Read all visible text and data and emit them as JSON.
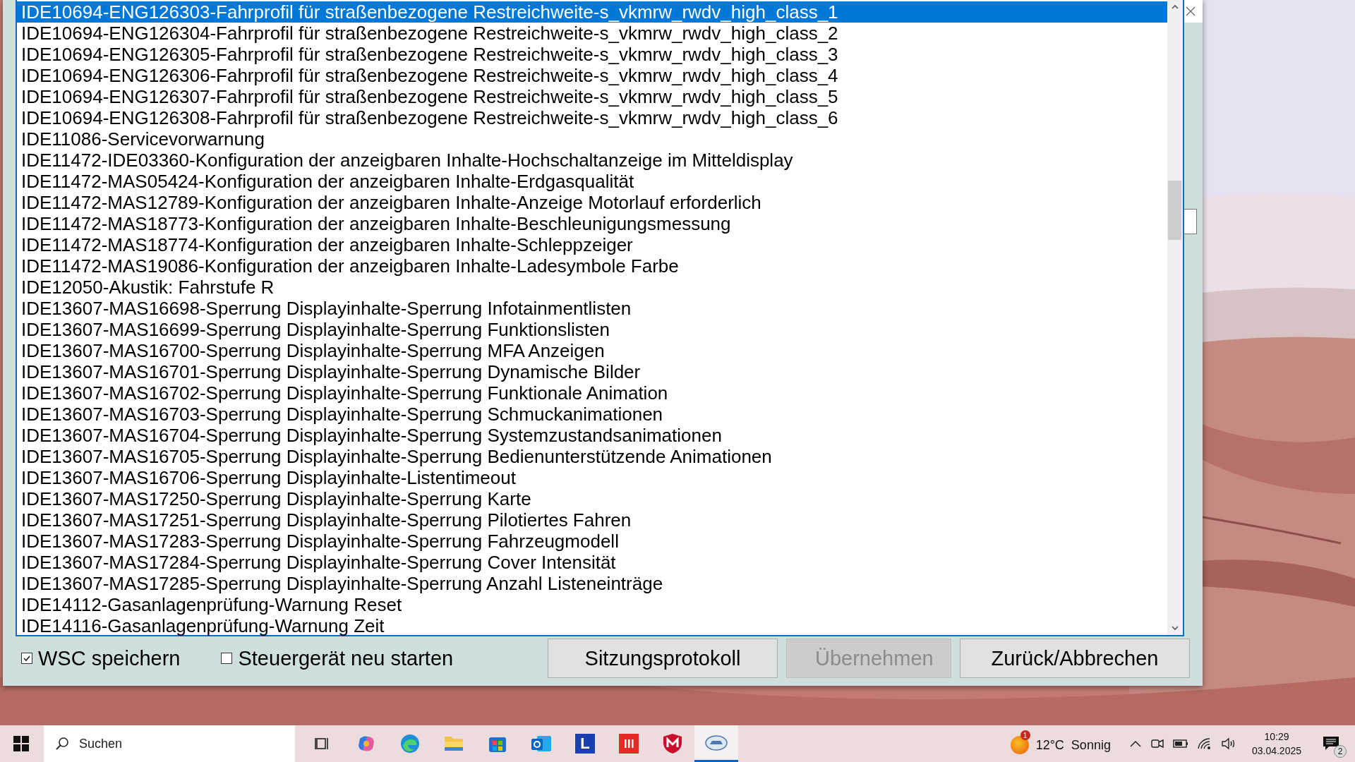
{
  "list": {
    "items": [
      {
        "text": "IDE10694-ENG126303-Fahrprofil für straßenbezogene Restreichweite-s_vkmrw_rwdv_high_class_1",
        "selected": true
      },
      {
        "text": "IDE10694-ENG126304-Fahrprofil für straßenbezogene Restreichweite-s_vkmrw_rwdv_high_class_2",
        "selected": false
      },
      {
        "text": "IDE10694-ENG126305-Fahrprofil für straßenbezogene Restreichweite-s_vkmrw_rwdv_high_class_3",
        "selected": false
      },
      {
        "text": "IDE10694-ENG126306-Fahrprofil für straßenbezogene Restreichweite-s_vkmrw_rwdv_high_class_4",
        "selected": false
      },
      {
        "text": "IDE10694-ENG126307-Fahrprofil für straßenbezogene Restreichweite-s_vkmrw_rwdv_high_class_5",
        "selected": false
      },
      {
        "text": "IDE10694-ENG126308-Fahrprofil für straßenbezogene Restreichweite-s_vkmrw_rwdv_high_class_6",
        "selected": false
      },
      {
        "text": "IDE11086-Servicevorwarnung",
        "selected": false
      },
      {
        "text": "IDE11472-IDE03360-Konfiguration der anzeigbaren Inhalte-Hochschaltanzeige im Mitteldisplay",
        "selected": false
      },
      {
        "text": "IDE11472-MAS05424-Konfiguration der anzeigbaren Inhalte-Erdgasqualität",
        "selected": false
      },
      {
        "text": "IDE11472-MAS12789-Konfiguration der anzeigbaren Inhalte-Anzeige Motorlauf erforderlich",
        "selected": false
      },
      {
        "text": "IDE11472-MAS18773-Konfiguration der anzeigbaren Inhalte-Beschleunigungsmessung",
        "selected": false
      },
      {
        "text": "IDE11472-MAS18774-Konfiguration der anzeigbaren Inhalte-Schleppzeiger",
        "selected": false
      },
      {
        "text": "IDE11472-MAS19086-Konfiguration der anzeigbaren Inhalte-Ladesymbole Farbe",
        "selected": false
      },
      {
        "text": "IDE12050-Akustik: Fahrstufe R",
        "selected": false
      },
      {
        "text": "IDE13607-MAS16698-Sperrung Displayinhalte-Sperrung Infotainmentlisten",
        "selected": false
      },
      {
        "text": "IDE13607-MAS16699-Sperrung Displayinhalte-Sperrung Funktionslisten",
        "selected": false
      },
      {
        "text": "IDE13607-MAS16700-Sperrung Displayinhalte-Sperrung MFA Anzeigen",
        "selected": false
      },
      {
        "text": "IDE13607-MAS16701-Sperrung Displayinhalte-Sperrung Dynamische Bilder",
        "selected": false
      },
      {
        "text": "IDE13607-MAS16702-Sperrung Displayinhalte-Sperrung Funktionale Animation",
        "selected": false
      },
      {
        "text": "IDE13607-MAS16703-Sperrung Displayinhalte-Sperrung Schmuckanimationen",
        "selected": false
      },
      {
        "text": "IDE13607-MAS16704-Sperrung Displayinhalte-Sperrung Systemzustandsanimationen",
        "selected": false
      },
      {
        "text": "IDE13607-MAS16705-Sperrung Displayinhalte-Sperrung Bedienunterstützende Animationen",
        "selected": false
      },
      {
        "text": "IDE13607-MAS16706-Sperrung Displayinhalte-Listentimeout",
        "selected": false
      },
      {
        "text": "IDE13607-MAS17250-Sperrung Displayinhalte-Sperrung Karte",
        "selected": false
      },
      {
        "text": "IDE13607-MAS17251-Sperrung Displayinhalte-Sperrung Pilotiertes Fahren",
        "selected": false
      },
      {
        "text": "IDE13607-MAS17283-Sperrung Displayinhalte-Sperrung Fahrzeugmodell",
        "selected": false
      },
      {
        "text": "IDE13607-MAS17284-Sperrung Displayinhalte-Sperrung Cover Intensität",
        "selected": false
      },
      {
        "text": "IDE13607-MAS17285-Sperrung Displayinhalte-Sperrung Anzahl Listeneinträge",
        "selected": false
      },
      {
        "text": "IDE14112-Gasanlagenprüfung-Warnung Reset",
        "selected": false
      },
      {
        "text": "IDE14116-Gasanlagenprüfung-Warnung Zeit",
        "selected": false
      }
    ]
  },
  "options": [
    {
      "label": "WSC speichern",
      "checked": true
    },
    {
      "label": "Steuergerät neu starten",
      "checked": false
    }
  ],
  "buttons": [
    {
      "label": "Sitzungsprotokoll",
      "disabled": false
    },
    {
      "label": "Übernehmen",
      "disabled": true
    },
    {
      "label": "Zurück/Abbrechen",
      "disabled": false
    }
  ],
  "taskbar": {
    "search": {
      "placeholder": "Suchen"
    },
    "apps": [
      {
        "kind": "taskview",
        "active": false
      },
      {
        "kind": "copilot",
        "active": false
      },
      {
        "kind": "edge",
        "active": false
      },
      {
        "kind": "explorer",
        "active": false
      },
      {
        "kind": "store",
        "active": false
      },
      {
        "kind": "outlook",
        "active": false
      },
      {
        "kind": "letter",
        "letter": "L",
        "active": false
      },
      {
        "kind": "bars",
        "active": false
      },
      {
        "kind": "shield",
        "active": false
      },
      {
        "kind": "vcds",
        "active": true
      }
    ],
    "weather": {
      "badge": "1",
      "temperature": "12°C",
      "condition": "Sonnig"
    },
    "time": "10:29",
    "date": "03.04.2025",
    "notifications": "2"
  }
}
